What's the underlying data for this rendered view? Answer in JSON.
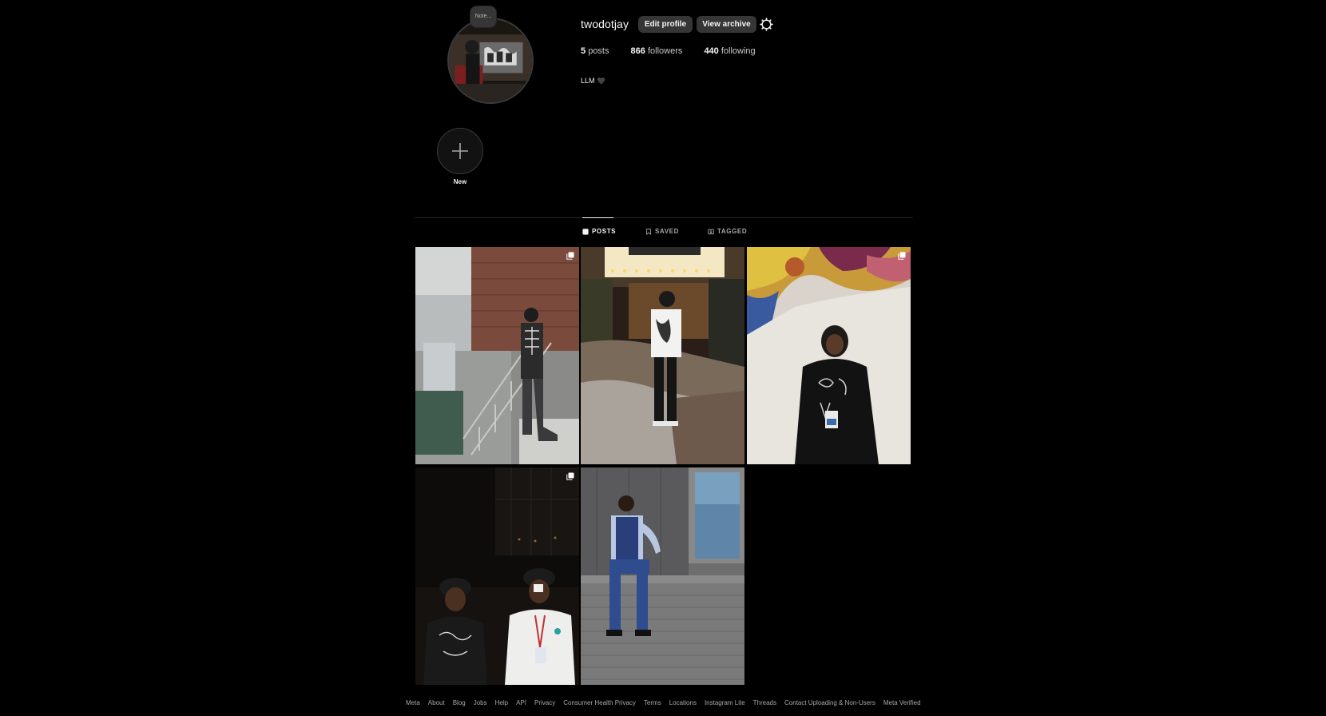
{
  "profile": {
    "username": "twodotjay",
    "note": "Note...",
    "edit_profile_label": "Edit profile",
    "view_archive_label": "View archive",
    "posts_count": "5",
    "posts_label": "posts",
    "followers_count": "866",
    "followers_label": "followers",
    "following_count": "440",
    "following_label": "following",
    "bio": "LLM",
    "bio_emoji": "🖤"
  },
  "highlights": {
    "new_label": "New"
  },
  "tabs": [
    {
      "label": "POSTS",
      "icon": "grid-icon",
      "active": true
    },
    {
      "label": "SAVED",
      "icon": "bookmark-icon",
      "active": false
    },
    {
      "label": "TAGGED",
      "icon": "tag-icon",
      "active": false
    }
  ],
  "posts": [
    {
      "multi": true
    },
    {
      "multi": false
    },
    {
      "multi": true
    },
    {
      "multi": true
    },
    {
      "multi": false
    }
  ],
  "footer": {
    "links": [
      "Meta",
      "About",
      "Blog",
      "Jobs",
      "Help",
      "API",
      "Privacy",
      "Consumer Health Privacy",
      "Terms",
      "Locations",
      "Instagram Lite",
      "Threads",
      "Contact Uploading & Non-Users",
      "Meta Verified"
    ]
  },
  "colors": {
    "background": "#000000",
    "button": "#363636",
    "text": "#f5f5f5",
    "muted": "#a8a8a8"
  }
}
